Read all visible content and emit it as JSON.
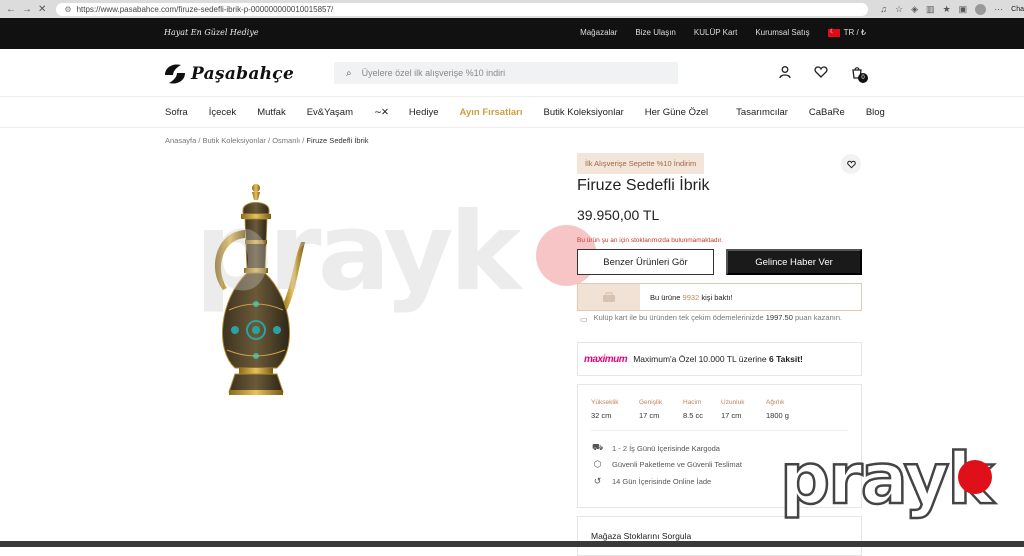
{
  "browser": {
    "url": "https://www.pasabahce.com/firuze-sedefli-ibrik-p-000000000010015857/",
    "profile_label": "Cha"
  },
  "top_strip": {
    "slogan": "Hayat En Güzel Hediye",
    "links": [
      "Mağazalar",
      "Bize Ulaşın",
      "KULÜP Kart",
      "Kurumsal Satış"
    ],
    "locale": "TR / ₺"
  },
  "header": {
    "logo_text": "Paşabahçe",
    "search_placeholder": "Üyelere özel ilk alışverişe %10 indiri",
    "cart_count": "0"
  },
  "nav": {
    "items": [
      "Sofra",
      "İçecek",
      "Mutfak",
      "Ev&Yaşam",
      "NX",
      "Hediye",
      "Ayın Fırsatları",
      "Butik Koleksiyonlar",
      "Her Güne Özel",
      "Tasarımcılar",
      "CaBaRe",
      "Blog"
    ],
    "highlight_index": 6
  },
  "breadcrumb": {
    "items": [
      "Anasayfa",
      "Butik Koleksiyonlar",
      "Osmanlı"
    ],
    "current": "Firuze Sedefli İbrik",
    "separator": " / "
  },
  "product": {
    "promo_badge": "İlk Alışverişe Sepette %10 İndirim",
    "title": "Firuze Sedefli İbrik",
    "price": "39.950,00 TL",
    "stock_message": "Bu ürün şu an için stoklarımızda bulunmamaktadır.",
    "similar_button": "Benzer Ürünleri Gör",
    "notify_button": "Gelince Haber Ver",
    "sold_prefix": "Bu ürüne",
    "sold_count": "9932",
    "sold_suffix": "kişi baktı!",
    "club_note_prefix": "Kulüp kart ile bu üründen tek çekim ödemelerinizde",
    "club_note_amount": "1997.50",
    "club_note_suffix": "puan kazanın.",
    "maximum_logo": "maximum",
    "maximum_text_prefix": "Maximum'a Özel 10.000 TL üzerine",
    "maximum_text_bold": "6 Taksit!"
  },
  "specs": [
    {
      "label": "Yükseklik",
      "value": "32 cm"
    },
    {
      "label": "Genişlik",
      "value": "17 cm"
    },
    {
      "label": "Hacim",
      "value": "8.5 cc"
    },
    {
      "label": "Uzunluk",
      "value": "17 cm"
    },
    {
      "label": "Ağırlık",
      "value": "1800 g"
    }
  ],
  "features": [
    {
      "icon": "truck-icon",
      "text": "1 - 2 İş Günü İçerisinde Kargoda"
    },
    {
      "icon": "box-icon",
      "text": "Güvenli Paketleme ve Güvenli Teslimat"
    },
    {
      "icon": "return-icon",
      "text": "14 Gün İçerisinde Online İade"
    }
  ],
  "store_stock": "Mağaza Stoklarını Sorgula",
  "watermark": "prayk",
  "colors": {
    "accent_gold": "#c8a046",
    "stock_red": "#c0392b",
    "maximum_pink": "#e6007e",
    "badge_bg": "#f3e5d8"
  }
}
